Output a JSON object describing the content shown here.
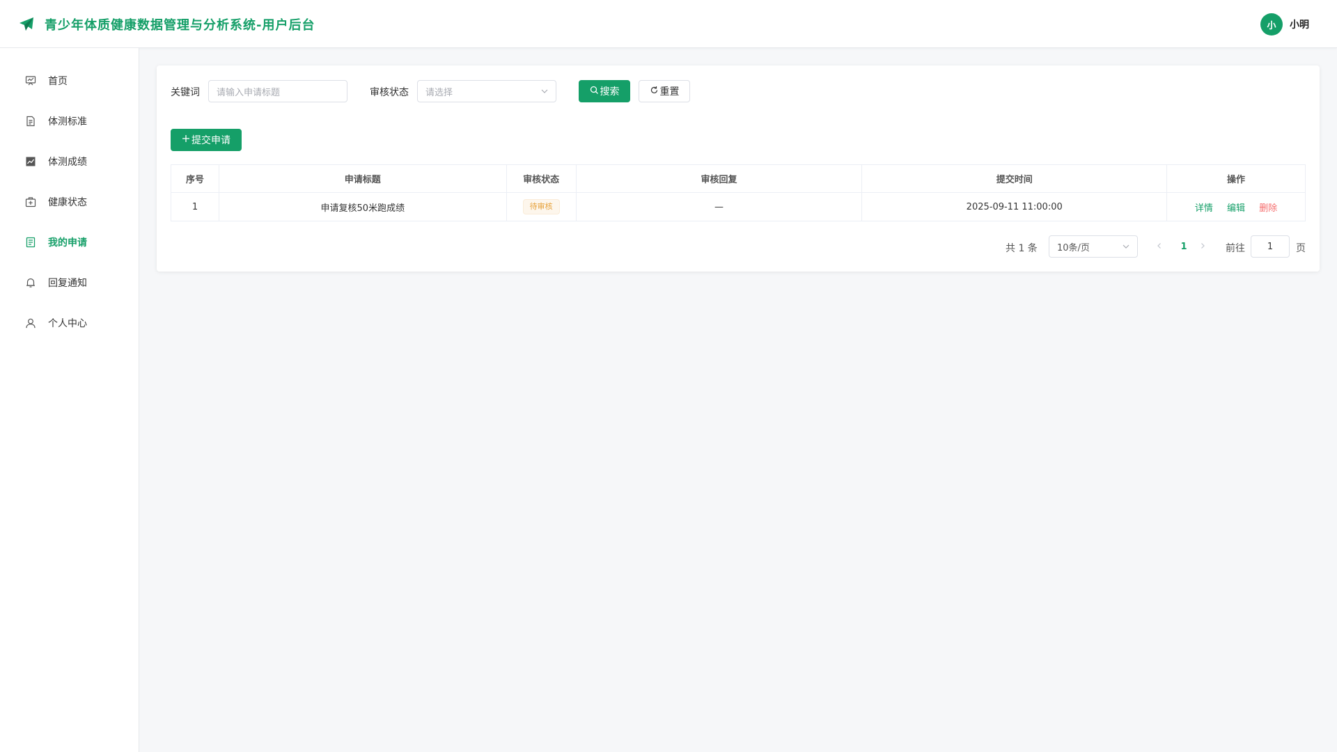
{
  "header": {
    "title": "青少年体质健康数据管理与分析系统-用户后台",
    "user_name": "小明",
    "avatar_text": "小"
  },
  "colors": {
    "primary": "#159f68",
    "warning": "#e6a23c",
    "danger": "#f56c6c"
  },
  "sidebar": {
    "items": [
      {
        "label": "首页",
        "icon": "dashboard-icon",
        "active": false
      },
      {
        "label": "体测标准",
        "icon": "document-icon",
        "active": false
      },
      {
        "label": "体测成绩",
        "icon": "chart-icon",
        "active": false
      },
      {
        "label": "健康状态",
        "icon": "medical-kit-icon",
        "active": false
      },
      {
        "label": "我的申请",
        "icon": "application-icon",
        "active": true
      },
      {
        "label": "回复通知",
        "icon": "bell-icon",
        "active": false
      },
      {
        "label": "个人中心",
        "icon": "user-icon",
        "active": false
      }
    ]
  },
  "filters": {
    "keyword_label": "关键词",
    "keyword_placeholder": "请输入申请标题",
    "status_label": "审核状态",
    "status_placeholder": "请选择",
    "search_label": "搜索",
    "reset_label": "重置"
  },
  "actions": {
    "submit_label": "提交申请"
  },
  "table": {
    "columns": [
      "序号",
      "申请标题",
      "审核状态",
      "审核回复",
      "提交时间",
      "操作"
    ],
    "rows": [
      {
        "index": "1",
        "title": "申请复核50米跑成绩",
        "status": "待审核",
        "reply": "—",
        "submitted_at": "2025-09-11 11:00:00",
        "ops": {
          "detail": "详情",
          "edit": "编辑",
          "delete": "删除"
        }
      }
    ]
  },
  "pagination": {
    "total_text": "共 1 条",
    "page_size": "10条/页",
    "current_page": "1",
    "goto_label": "前往",
    "goto_value": "1",
    "page_unit": "页"
  }
}
